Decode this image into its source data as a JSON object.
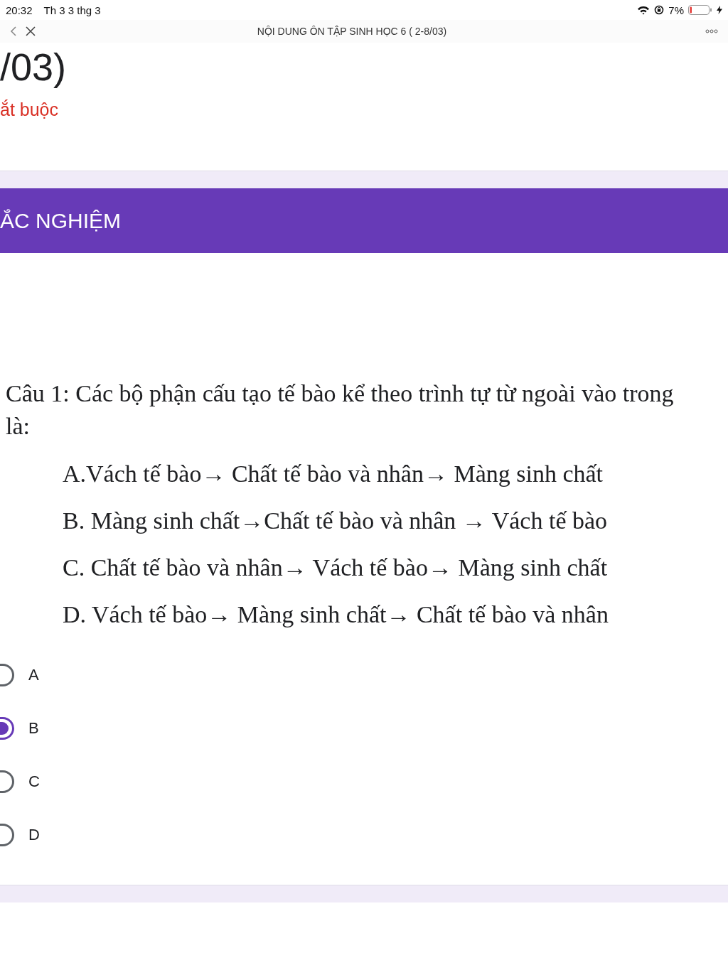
{
  "status_bar": {
    "time": "20:32",
    "date": "Th 3 3 thg 3",
    "battery": "7%"
  },
  "nav_bar": {
    "title": "NỘI DUNG ÔN TẬP SINH HỌC 6 ( 2-8/03)"
  },
  "form": {
    "title": "/03)",
    "required_note": "ắt buộc"
  },
  "section": {
    "title": "ẮC NGHIỆM"
  },
  "question": {
    "text": "Câu 1: Các bộ phận cấu tạo tế bào kể theo trình tự từ ngoài vào trong là:",
    "options": [
      "A.Vách tế bào→ Chất tế bào và nhân→ Màng sinh chất",
      "B. Màng sinh chất→Chất tế bào và nhân → Vách tế bào",
      "C. Chất tế bào và nhân→ Vách tế bào→ Màng sinh chất",
      "D. Vách tế bào→ Màng sinh chất→ Chất tế bào và nhân"
    ],
    "choices": [
      {
        "label": "A",
        "selected": false
      },
      {
        "label": "B",
        "selected": true
      },
      {
        "label": "C",
        "selected": false
      },
      {
        "label": "D",
        "selected": false
      }
    ]
  }
}
